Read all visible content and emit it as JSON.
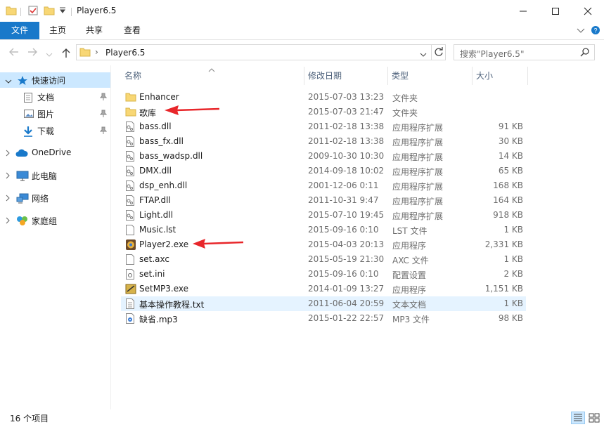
{
  "window": {
    "title": "Player6.5"
  },
  "ribbon": {
    "tabs": [
      {
        "label": "文件"
      },
      {
        "label": "主页"
      },
      {
        "label": "共享"
      },
      {
        "label": "查看"
      }
    ]
  },
  "address": {
    "path": "Player6.5",
    "search_placeholder": "搜索\"Player6.5\""
  },
  "sidebar": {
    "quick_access": "快速访问",
    "quick_items": [
      {
        "label": "文档",
        "icon": "documents-icon"
      },
      {
        "label": "图片",
        "icon": "pictures-icon"
      },
      {
        "label": "下载",
        "icon": "download-icon"
      }
    ],
    "onedrive": "OneDrive",
    "this_pc": "此电脑",
    "network": "网络",
    "homegroup": "家庭组"
  },
  "columns": {
    "name": "名称",
    "date": "修改日期",
    "type": "类型",
    "size": "大小"
  },
  "files": [
    {
      "name": "Enhancer",
      "date": "2015-07-03 13:23",
      "type": "文件夹",
      "size": "",
      "icon": "folder-icon"
    },
    {
      "name": "歌库",
      "date": "2015-07-03 21:47",
      "type": "文件夹",
      "size": "",
      "icon": "folder-icon"
    },
    {
      "name": "bass.dll",
      "date": "2011-02-18 13:38",
      "type": "应用程序扩展",
      "size": "91 KB",
      "icon": "dll-icon"
    },
    {
      "name": "bass_fx.dll",
      "date": "2011-02-18 13:38",
      "type": "应用程序扩展",
      "size": "30 KB",
      "icon": "dll-icon"
    },
    {
      "name": "bass_wadsp.dll",
      "date": "2009-10-30 10:30",
      "type": "应用程序扩展",
      "size": "14 KB",
      "icon": "dll-icon"
    },
    {
      "name": "DMX.dll",
      "date": "2014-09-18 10:02",
      "type": "应用程序扩展",
      "size": "65 KB",
      "icon": "dll-icon"
    },
    {
      "name": "dsp_enh.dll",
      "date": "2001-12-06 0:11",
      "type": "应用程序扩展",
      "size": "168 KB",
      "icon": "dll-icon"
    },
    {
      "name": "FTAP.dll",
      "date": "2011-10-31 9:47",
      "type": "应用程序扩展",
      "size": "164 KB",
      "icon": "dll-icon"
    },
    {
      "name": "Light.dll",
      "date": "2015-07-10 19:45",
      "type": "应用程序扩展",
      "size": "918 KB",
      "icon": "dll-icon"
    },
    {
      "name": "Music.lst",
      "date": "2015-09-16 0:10",
      "type": "LST 文件",
      "size": "1 KB",
      "icon": "file-icon"
    },
    {
      "name": "Player2.exe",
      "date": "2015-04-03 20:13",
      "type": "应用程序",
      "size": "2,331 KB",
      "icon": "player-exe-icon"
    },
    {
      "name": "set.axc",
      "date": "2015-05-19 21:30",
      "type": "AXC 文件",
      "size": "1 KB",
      "icon": "file-icon"
    },
    {
      "name": "set.ini",
      "date": "2015-09-16 0:10",
      "type": "配置设置",
      "size": "2 KB",
      "icon": "settings-file-icon"
    },
    {
      "name": "SetMP3.exe",
      "date": "2014-01-09 13:27",
      "type": "应用程序",
      "size": "1,151 KB",
      "icon": "setmp3-exe-icon"
    },
    {
      "name": "基本操作教程.txt",
      "date": "2011-06-04 20:59",
      "type": "文本文档",
      "size": "1 KB",
      "icon": "text-file-icon"
    },
    {
      "name": "缺省.mp3",
      "date": "2015-01-22 22:57",
      "type": "MP3 文件",
      "size": "98 KB",
      "icon": "audio-file-icon"
    }
  ],
  "status": {
    "count": "16 个项目"
  },
  "colors": {
    "accent": "#1979ca",
    "hover_row": "#e5f3ff",
    "sidebar_selected": "#cce8ff",
    "annotation_arrow": "#e8262a",
    "folder": "#f8d775"
  }
}
